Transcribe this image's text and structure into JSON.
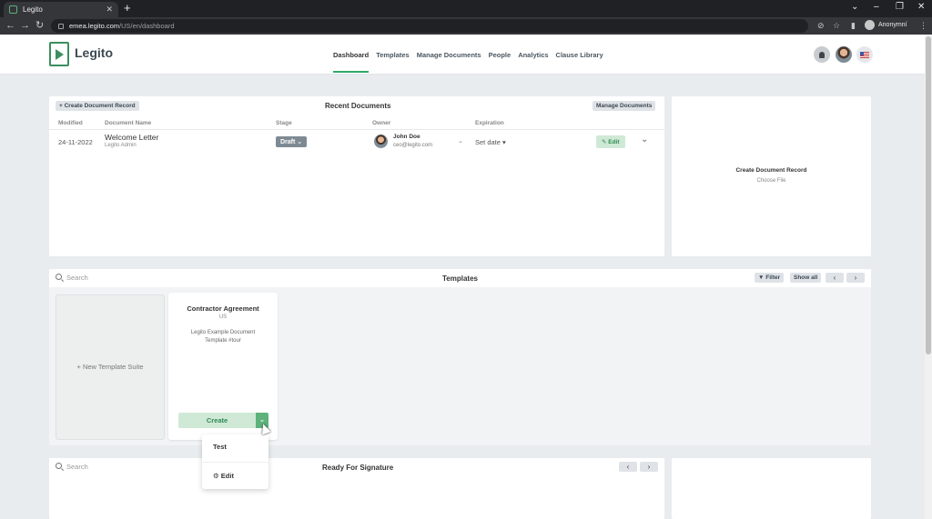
{
  "browser": {
    "tab_title": "Legito",
    "tab_close": "✕",
    "new_tab": "+",
    "url_host": "emea.legito.com",
    "url_path": "/US/en/dashboard",
    "profile_name": "Anonymní",
    "controls": {
      "dropdown": "⌄",
      "minimize": "–",
      "restore": "❐",
      "close": "✕"
    }
  },
  "header": {
    "logo_text": "Legito",
    "nav": [
      {
        "label": "Dashboard",
        "active": true
      },
      {
        "label": "Templates"
      },
      {
        "label": "Manage Documents"
      },
      {
        "label": "People"
      },
      {
        "label": "Analytics"
      },
      {
        "label": "Clause Library"
      }
    ]
  },
  "recent": {
    "title": "Recent Documents",
    "create_button": "+ Create Document Record",
    "manage_button": "Manage Documents",
    "columns": [
      "Modified",
      "Document Name",
      "Stage",
      "Owner",
      "Expiration"
    ],
    "rows": [
      {
        "modified": "24-11-2022",
        "name": "Welcome Letter",
        "sub": "Legito Admin",
        "stage": "Draft ⌄",
        "owner_name": "John Doe",
        "owner_email": "ceo@legito.com",
        "expiration": "Set date ▾",
        "edit_label": "✎ Edit"
      }
    ]
  },
  "side_create": {
    "title": "Create Document Record",
    "subtitle": "Choose File"
  },
  "templates": {
    "title": "Templates",
    "search_placeholder": "Search",
    "filter_button": "Filter",
    "show_all_button": "Show all",
    "new_suite": "+ New Template Suite",
    "card": {
      "name": "Contractor Agreement",
      "country": "US",
      "description": "Legito Example Document Template #tour",
      "create_label": "Create"
    },
    "dropdown": [
      {
        "label": "Test"
      },
      {
        "label": "⚙ Edit"
      }
    ]
  },
  "ready": {
    "title": "Ready For Signature",
    "search_placeholder": "Search"
  },
  "colors": {
    "accent": "#2fa866",
    "accent_light": "#cfe9d6",
    "stage_badge": "#7e8a93"
  }
}
